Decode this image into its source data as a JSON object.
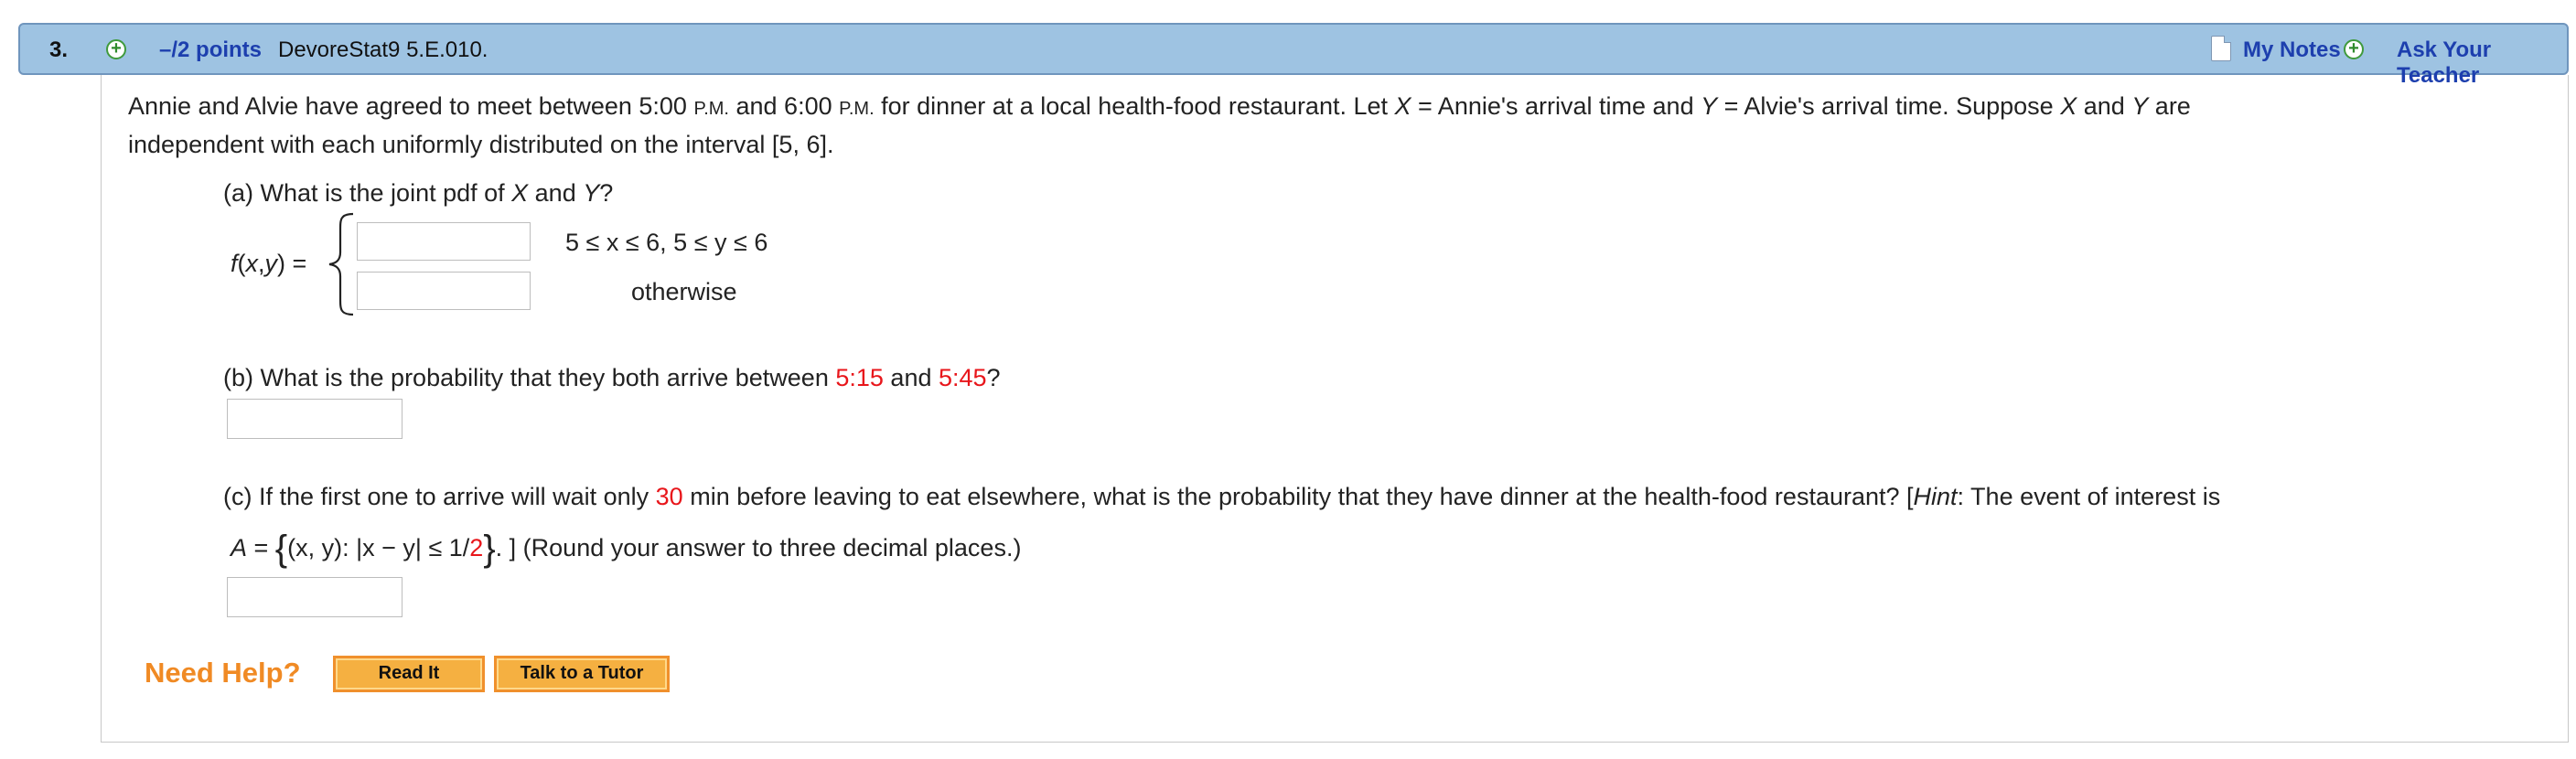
{
  "header": {
    "question_number": "3.",
    "points": "–/2 points",
    "source": "DevoreStat9 5.E.010.",
    "my_notes": "My Notes",
    "ask_teacher": "Ask Your Teacher"
  },
  "intro": {
    "line1_a": "Annie and Alvie have agreed to meet between 5:00 ",
    "pm": "P.M.",
    "line1_b": " and 6:00 ",
    "line1_c": " for dinner at a local health-food restaurant. Let ",
    "X": "X",
    "line1_d": " = Annie's arrival time and ",
    "Y": "Y",
    "line1_e": " = Alvie's arrival time. Suppose ",
    "line1_f": " and ",
    "line1_g": " are",
    "line2": "independent with each uniformly distributed on the interval [5, 6]."
  },
  "part_a": {
    "question_a": "(a) What is the joint pdf of ",
    "question_b": " and ",
    "question_c": "?",
    "fxy_f": "f",
    "fxy_args": "(",
    "fxy_x": "x",
    "fxy_comma": ",",
    "fxy_y": "y",
    "fxy_end": ") =",
    "cond1": "5 ≤ x ≤ 6, 5 ≤ y ≤ 6",
    "cond2": "otherwise",
    "input1_value": "",
    "input2_value": ""
  },
  "part_b": {
    "question_a": "(b) What is the probability that they both arrive between ",
    "time1": "5:15",
    "and": " and ",
    "time2": "5:45",
    "question_end": "?",
    "input_value": ""
  },
  "part_c": {
    "question_a": "(c) If the first one to arrive will wait only ",
    "minutes": "30",
    "question_b": " min before leaving to eat elsewhere, what is the probability that they have dinner at the health-food restaurant? [",
    "hint": "Hint",
    "question_c": ": The event of interest is",
    "A_label": "A",
    "A_eq": " = ",
    "set_open": "{",
    "set_a": "(x, y): |x − y| ≤ 1/",
    "set_red": "2",
    "set_close": "}",
    "set_after": ". ] (Round your answer to three decimal places.)",
    "input_value": ""
  },
  "help": {
    "need_help": "Need Help?",
    "read_it": "Read It",
    "talk_tutor": "Talk to a Tutor"
  },
  "colors": {
    "header_bg": "#9ec3e2",
    "link_blue": "#1d3fae",
    "highlight_red": "#e8161b",
    "need_help_orange": "#f08a24",
    "button_orange": "#f5b041"
  }
}
